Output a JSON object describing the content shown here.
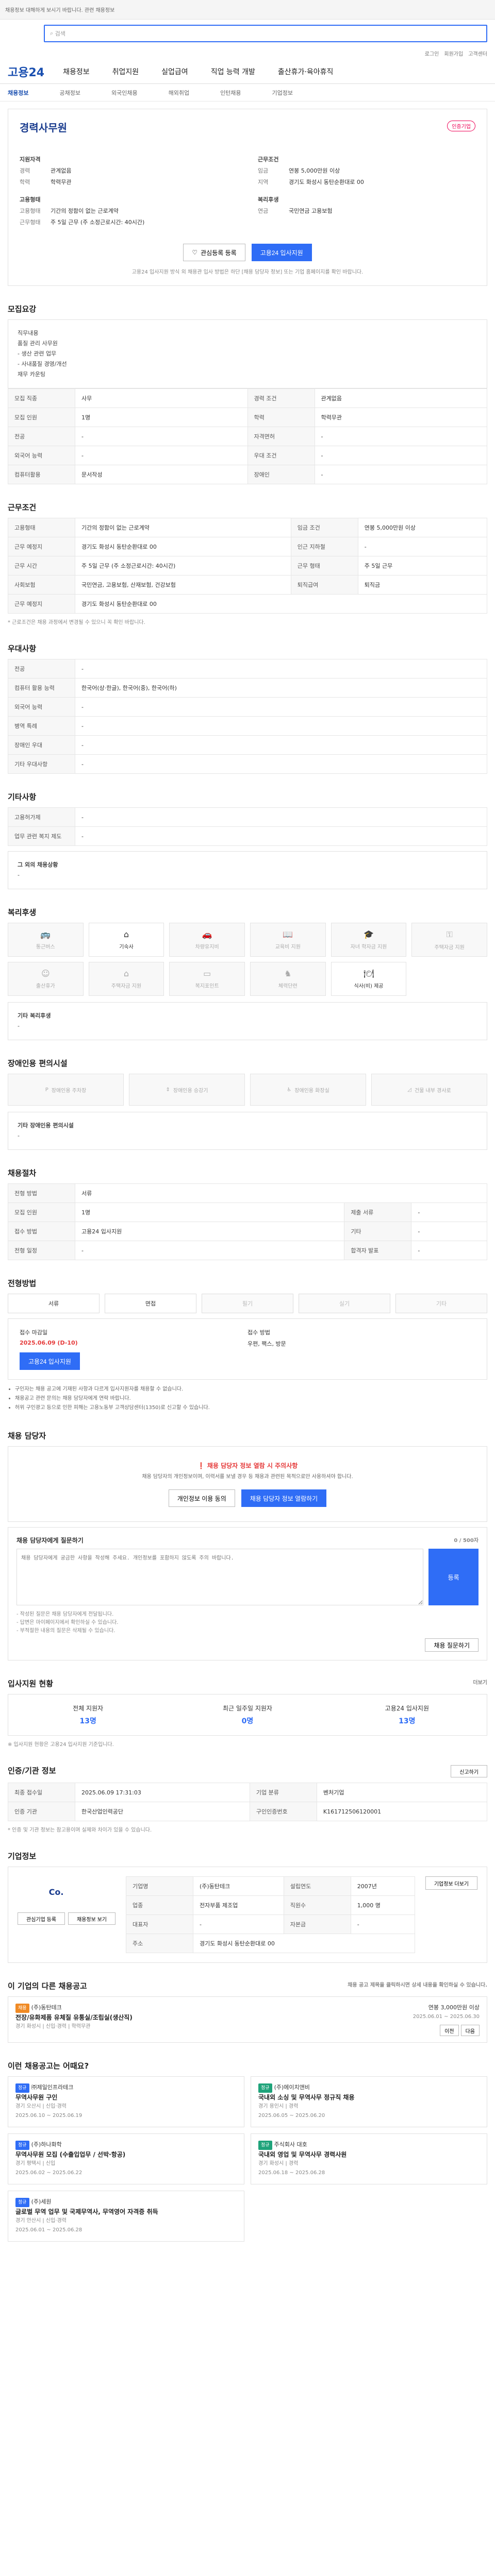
{
  "top": {
    "notice": "채용정보 대해하게 보시기 바랍니다. 관련 채용정보",
    "search_placeholder": "검색"
  },
  "util_links": [
    "로그인",
    "회원가입",
    "고객센터"
  ],
  "nav": {
    "logo": "고용24",
    "items": [
      "채용정보",
      "취업지원",
      "실업급여",
      "직업 능력 개발",
      "출산휴가·육아휴직"
    ]
  },
  "subnav": [
    "채용정보",
    "공채정보",
    "외국인채용",
    "해외취업",
    "인턴채용",
    "기업정보"
  ],
  "job": {
    "title": "경력사무원",
    "cert_badge": "인증기업",
    "recruit_label": "지원자격",
    "career_k": "경력",
    "career_v": "관계없음",
    "edu_k": "학력",
    "edu_v": "학력무관",
    "cond_label": "근무조건",
    "pay_k": "임금",
    "pay_v": "연봉 5,000만원 이상",
    "loc_k": "지역",
    "loc_v": "경기도 화성시 동탄순환대로 00",
    "type_label": "고용형태",
    "type_k": "고용형태",
    "type_v": "기간의 정함이 없는 근로계약",
    "hours_k": "근무형태",
    "hours_v": "주 5일 근무 (주 소정근로시간: 40시간)",
    "benefit_label": "복리후생",
    "benefit_k": "연금",
    "benefit_v": "국민연금 고용보험",
    "btn_save": "관심등록 등록",
    "btn_apply": "고용24 입사지원",
    "apply_notice": "고용24 입사지원 방식 외 채용관 입사 방법은 하단 [채용 담당자 정보] 또는 기업 홈페이지를 확인 바랍니다."
  },
  "summary": {
    "title": "모집요강",
    "intro": [
      "직무내용",
      "품질 관리 사무원",
      "- 생산 관련 업무",
      "- 사내품질 경영/개선",
      "재무 카운팅"
    ],
    "rows": [
      {
        "k1": "모집 직종",
        "v1": "사무",
        "k2": "경력 조건",
        "v2": "관계없음"
      },
      {
        "k1": "모집 인원",
        "v1": "1명",
        "k2": "학력",
        "v2": "학력무관"
      },
      {
        "k1": "전공",
        "v1": "-",
        "k2": "자격면허",
        "v2": "-"
      },
      {
        "k1": "외국어 능력",
        "v1": "-",
        "k2": "우대 조건",
        "v2": "-"
      },
      {
        "k1": "컴퓨터활용",
        "v1": "문서작성",
        "k2": "장애인",
        "v2": "-"
      }
    ]
  },
  "conditions": {
    "title": "근무조건",
    "rows": [
      {
        "k1": "고용형태",
        "v1": "기간의 정함이 없는 근로계약",
        "k2": "임금 조건",
        "v2": "연봉 5,000만원 이상"
      },
      {
        "k1": "근무 예정지",
        "v1": "경기도 화성시 동탄순환대로 00",
        "k2": "인근 지하철",
        "v2": "-"
      },
      {
        "k1": "근무 시간",
        "v1": "주 5일 근무 (주 소정근로시간: 40시간)",
        "k2": "근무 형태",
        "v2": "주 5일 근무"
      },
      {
        "k1": "사회보험",
        "v1": "국민연금, 고용보험, 산재보험, 건강보험",
        "k2": "퇴직급여",
        "v2": "퇴직금"
      },
      {
        "k1": "근무 예정지",
        "v1": "경기도 화성시 동탄순환대로 00",
        "k2": "",
        "v2": ""
      }
    ],
    "footnote": "* 근로조건은 채용 과정에서 변경될 수 있으니 꼭 확인 바랍니다."
  },
  "preferred": {
    "title": "우대사항",
    "rows": [
      {
        "k": "전공",
        "v": "-"
      },
      {
        "k": "컴퓨터 활용 능력",
        "v": "한국어(상·한글), 한국어(중), 한국어(하)"
      },
      {
        "k": "외국어 능력",
        "v": "-"
      },
      {
        "k": "병역 특례",
        "v": "-"
      },
      {
        "k": "장애인 우대",
        "v": "-"
      },
      {
        "k": "기타 우대사항",
        "v": "-"
      }
    ]
  },
  "etc": {
    "title": "기타사항",
    "rows": [
      {
        "k": "고용허가제",
        "v": "-"
      },
      {
        "k": "업무 관련 복지 제도",
        "v": "-"
      }
    ],
    "extra_label": "그 외의 채용상황",
    "extra_value": "-"
  },
  "welfare": {
    "title": "복리후생",
    "items": [
      {
        "label": "통근버스",
        "icon": "bus-icon",
        "on": false
      },
      {
        "label": "기숙사",
        "icon": "house-icon",
        "on": true
      },
      {
        "label": "차량유지비",
        "icon": "car-icon",
        "on": false
      },
      {
        "label": "교육비 지원",
        "icon": "book-icon",
        "on": false
      },
      {
        "label": "자녀 학자금 지원",
        "icon": "cap-icon",
        "on": false
      },
      {
        "label": "주택자금 지원",
        "icon": "key-icon",
        "on": false
      },
      {
        "label": "출산휴가",
        "icon": "baby-icon",
        "on": false
      },
      {
        "label": "주택자금 지원",
        "icon": "home-icon",
        "on": false
      },
      {
        "label": "복지포인트",
        "icon": "card-icon",
        "on": false
      },
      {
        "label": "체력단련",
        "icon": "gym-icon",
        "on": false
      },
      {
        "label": "식사(비) 제공",
        "icon": "meal-icon",
        "on": true
      }
    ],
    "etc_label": "기타 복리후생",
    "etc_value": "-"
  },
  "disability": {
    "title": "장애인용 편의시설",
    "items": [
      "장애인용 주차장",
      "장애인용 승강기",
      "장애인용 화장실",
      "건물 내부 경사로"
    ],
    "etc_label": "기타 장애인용 편의시설",
    "etc_value": "-"
  },
  "process": {
    "title": "채용절차",
    "rows": [
      {
        "k1": "전형 방법",
        "v1": "서류",
        "k2": "",
        "v2": ""
      },
      {
        "k1": "모집 인원",
        "v1": "1명",
        "k2": "제출 서류",
        "v2": "-"
      },
      {
        "k1": "접수 방법",
        "v1": "고용24 입사지원",
        "k2": "기타",
        "v2": "-"
      },
      {
        "k1": "전형 일정",
        "v1": "-",
        "k2": "합격자 발표",
        "v2": "-"
      }
    ]
  },
  "apply": {
    "title": "전형방법",
    "methods": [
      {
        "label": "서류",
        "on": true
      },
      {
        "label": "면접",
        "on": true
      },
      {
        "label": "필기",
        "on": false
      },
      {
        "label": "실기",
        "on": false
      },
      {
        "label": "기타",
        "on": false
      }
    ],
    "period_label": "접수 마감일",
    "period_value": "2025.06.09 (D-10)",
    "method_label": "접수 방법",
    "method_value": "우편, 팩스, 방문",
    "apply_btn": "고용24 입사지원",
    "bullets": [
      "구인자는 채용 공고에 기재된 사항과 다르게 입사지원자를 채용할 수 없습니다.",
      "채용공고 관련 문의는 채용 담당자에게 연락 바랍니다.",
      "허위 구인광고 등으로 인한 피해는 고용노동부 고객상담센터(1350)로 신고할 수 있습니다."
    ]
  },
  "manager": {
    "title": "채용 담당자",
    "warn": "채용 담당자 정보 열람 시 주의사항",
    "desc": "채용 담당자의 개인정보이며, 이력서를 보낼 경우 등 채용과 관련된 목적으로만 사용하셔야 합니다.",
    "btn_agree": "개인정보 이용 동의",
    "btn_view": "채용 담당자 정보 열람하기"
  },
  "qa": {
    "title": "채용 담당자에게 질문하기",
    "placeholder": "채용 담당자에게 궁금한 사항을 작성해 주세요. 개인정보를 포함하지 않도록 주의 바랍니다.",
    "counter": "0 / 500자",
    "submit": "등록",
    "notes": [
      "- 작성된 질문은 채용 담당자에게 전달됩니다.",
      "- 답변은 마이페이지에서 확인하실 수 있습니다.",
      "- 부적절한 내용의 질문은 삭제될 수 있습니다."
    ],
    "btn_more": "채용 질문하기"
  },
  "stats": {
    "title": "입사지원 현황",
    "more": "더보기",
    "items": [
      {
        "label": "전체 지원자",
        "value": "13명"
      },
      {
        "label": "최근 일주일 지원자",
        "value": "0명"
      },
      {
        "label": "고용24 입사지원",
        "value": "13명"
      }
    ],
    "note": "※ 입사지원 현황은 고용24 입사지원 기준입니다."
  },
  "info": {
    "title": "인증/기관 정보",
    "btn_report": "신고하기",
    "rows": [
      {
        "k1": "최종 접수일",
        "v1": "2025.06.09 17:31:03",
        "k2": "기업 분류",
        "v2": "벤처기업"
      },
      {
        "k1": "인증 기관",
        "v1": "한국산업인력공단",
        "k2": "구인인증번호",
        "v2": "K161712506120001"
      }
    ],
    "note": "* 인증 및 기관 정보는 참고용이며 실제와 차이가 있을 수 있습니다."
  },
  "company": {
    "title": "기업정보",
    "logo_text": "Co.",
    "rows": [
      {
        "k1": "기업명",
        "v1": "(주)동탄테크",
        "k2": "설립연도",
        "v2": "2007년"
      },
      {
        "k1": "업종",
        "v1": "전자부품 제조업",
        "k2": "직원수",
        "v2": "1,000 명"
      },
      {
        "k1": "대표자",
        "v1": "-",
        "k2": "자본금",
        "v2": "-"
      },
      {
        "k1": "주소",
        "v1": "경기도 화성시 동탄순환대로 00",
        "k2": "",
        "v2": ""
      }
    ],
    "btn_info": "기업정보 더보기",
    "btn_fav": "관심기업 등록",
    "btn_more": "채용정보 보기"
  },
  "other_jobs": {
    "title": "이 기업의 다른 채용공고",
    "subtitle": "채용 공고 제목을 클릭하시면 상세 내용을 확인하실 수 있습니다.",
    "card": {
      "tag": "채용",
      "company": "(주)동탄테크",
      "title": "전장/유화제품 유체질 유통실/조립실(생산직)",
      "meta": "경기 화성시 | 신입·경력 | 학력무관",
      "pay": "연봉 3,000만원 이상",
      "date": "2025.06.01 ~ 2025.06.30"
    },
    "btn_prev": "이전",
    "btn_next": "다음"
  },
  "similar": {
    "title": "이런 채용공고는 어때요?",
    "cards": [
      {
        "tag": "정규",
        "company": "㈜제일인프라테크",
        "title": "무역사무원 구인",
        "meta": "경기 오산시 | 신입·경력",
        "date": "2025.06.10 ~ 2025.06.19"
      },
      {
        "tag": "정규",
        "company": "(주)에이치앤비",
        "title": "국내외 소싱 및 무역사무 정규직 채용",
        "meta": "경기 용인시 | 경력",
        "date": "2025.06.05 ~ 2025.06.20"
      },
      {
        "tag": "정규",
        "company": "(주)하나화학",
        "title": "무역사무원 모집 (수출입업무 / 선박·항공)",
        "meta": "경기 평택시 | 신입",
        "date": "2025.06.02 ~ 2025.06.22"
      },
      {
        "tag": "정규",
        "company": "주식회사 대호",
        "title": "국내외 영업 및 무역사무 경력사원",
        "meta": "경기 화성시 | 경력",
        "date": "2025.06.18 ~ 2025.06.28"
      },
      {
        "tag": "정규",
        "company": "(주)세원",
        "title": "글로벌 무역 업무 및 국제무역사, 무역영어 자격증 취득",
        "meta": "경기 안산시 | 신입·경력",
        "date": "2025.06.01 ~ 2025.06.28"
      }
    ]
  }
}
